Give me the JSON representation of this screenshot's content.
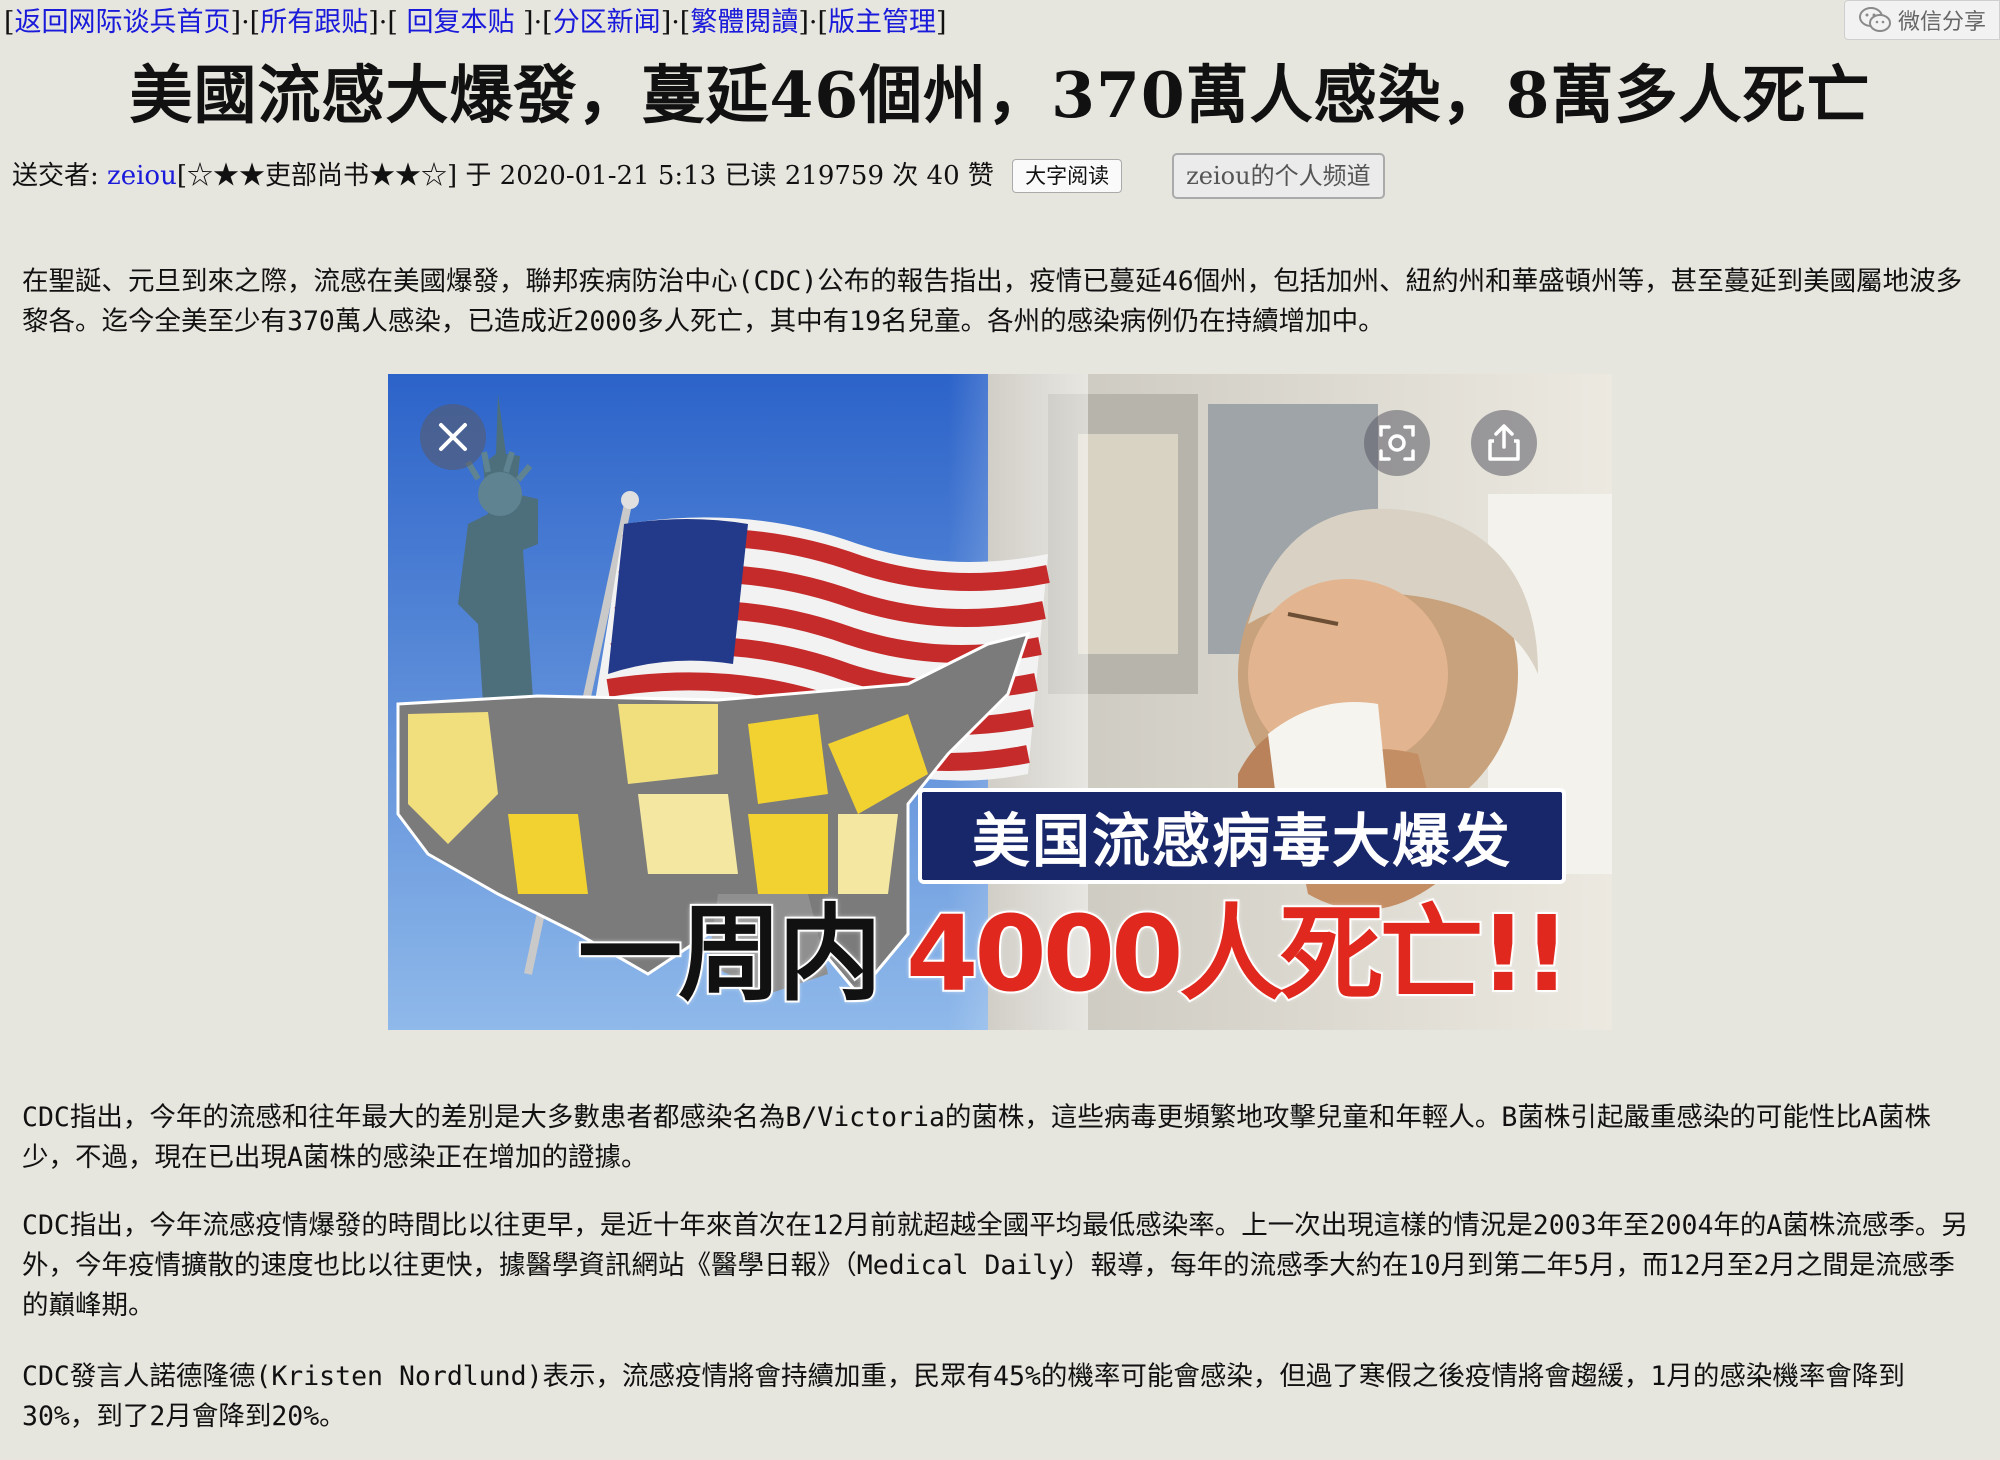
{
  "nav": {
    "links": [
      "返回网际谈兵首页",
      "所有跟贴",
      " 回复本贴 ",
      "分区新闻",
      "繁體閱讀",
      "版主管理"
    ],
    "wechat_share_label": "微信分享"
  },
  "title": "美國流感大爆發，蔓延46個州，370萬人感染，8萬多人死亡",
  "meta": {
    "prefix": "送交者: ",
    "author": "zeiou",
    "rank": "[☆★★吏部尚书★★☆]",
    "posted": " 于 2020-01-21 5:13 已读 219759 次 40 赞 ",
    "large_font_button": "大字阅读",
    "channel_button": "zeiou的个人频道"
  },
  "paragraphs": [
    "在聖誕、元旦到來之際，流感在美國爆發，聯邦疾病防治中心(CDC)公布的報告指出，疫情已蔓延46個州，包括加州、紐約州和華盛頓州等，甚至蔓延到美國屬地波多黎各。迄今全美至少有370萬人感染，已造成近2000多人死亡，其中有19名兒童。各州的感染病例仍在持續增加中。",
    "CDC指出，今年的流感和往年最大的差別是大多數患者都感染名為B/Victoria的菌株，這些病毒更頻繁地攻擊兒童和年輕人。B菌株引起嚴重感染的可能性比A菌株少，不過，現在已出現A菌株的感染正在增加的證據。",
    "CDC指出，今年流感疫情爆發的時間比以往更早，是近十年來首次在12月前就超越全國平均最低感染率。上一次出現這樣的情況是2003年至2004年的A菌株流感季。另外，今年疫情擴散的速度也比以往更快，據醫學資訊網站《醫學日報》（Medical Daily）報導，每年的流感季大約在10月到第二年5月，而12月至2月之間是流感季的巔峰期。",
    "CDC發言人諾德隆德(Kristen Nordlund)表示，流感疫情將會持續加重，民眾有45%的機率可能會感染，但過了寒假之後疫情將會趨緩，1月的感染機率會降到30%，到了2月會降到20%。"
  ],
  "image": {
    "caption_banner": "美国流感病毒大爆发",
    "headline_black": "一周内",
    "headline_red": "4000人死亡!!",
    "icons": [
      "close-icon",
      "lens-icon",
      "share-icon"
    ]
  },
  "colors": {
    "link": "#1a1adb",
    "background": "#e6e5de",
    "banner": "#18266a",
    "headline_red": "#e0281e"
  }
}
